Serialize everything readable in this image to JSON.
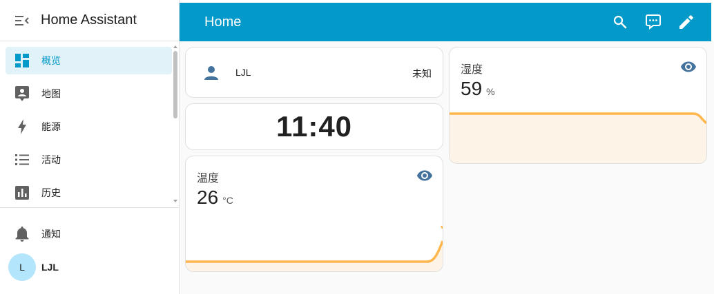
{
  "sidebar": {
    "title": "Home Assistant",
    "items": [
      {
        "label": "概览",
        "icon": "dashboard-icon",
        "active": true
      },
      {
        "label": "地图",
        "icon": "map-account-icon"
      },
      {
        "label": "能源",
        "icon": "lightning-bolt-icon"
      },
      {
        "label": "活动",
        "icon": "format-list-icon"
      },
      {
        "label": "历史",
        "icon": "chart-box-icon"
      }
    ],
    "notifications_label": "通知",
    "user": {
      "initial": "L",
      "name": "LJL"
    }
  },
  "header": {
    "title": "Home",
    "actions": [
      "search-icon",
      "assist-chat-icon",
      "edit-pencil-icon"
    ]
  },
  "cards": {
    "person": {
      "name": "LJL",
      "state": "未知"
    },
    "clock": {
      "time": "11:40"
    },
    "temperature": {
      "name": "温度",
      "value": "26",
      "unit": "°C"
    },
    "humidity": {
      "name": "湿度",
      "value": "59",
      "unit": "%"
    }
  },
  "colors": {
    "accent": "#0399c9",
    "graph_line": "#ffb74d",
    "graph_fill": "#fdf3e6",
    "icon_blue": "#44739e",
    "sidebar_active_bg": "#e1f2f8"
  }
}
